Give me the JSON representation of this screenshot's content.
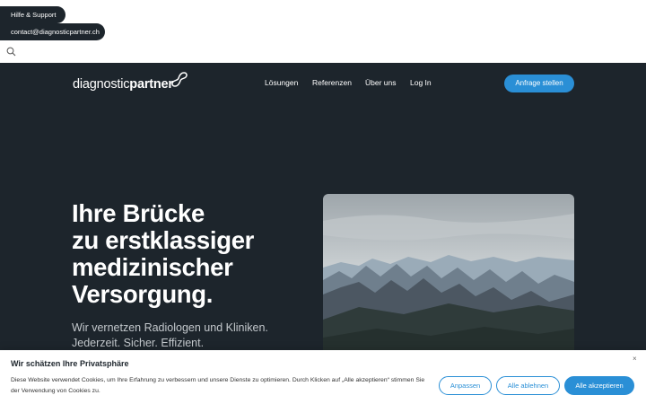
{
  "topbar": {
    "help_label": "Hilfe & Support",
    "email_label": "contact@diagnosticpartner.ch",
    "search_icon": "search-icon"
  },
  "header": {
    "logo_light": "diagnostic",
    "logo_bold": "partner",
    "nav": [
      "Lösungen",
      "Referenzen",
      "Über uns",
      "Log In"
    ],
    "cta_label": "Anfrage stellen"
  },
  "hero": {
    "headline": [
      "Ihre Brücke",
      "zu erstklassiger",
      "medizinischer",
      "Versorgung."
    ],
    "subline": [
      "Wir vernetzen Radiologen und Kliniken.",
      "Jederzeit. Sicher. Effizient."
    ]
  },
  "cookie_banner": {
    "title": "Wir schätzen Ihre Privatsphäre",
    "text": "Diese Website verwendet Cookies, um Ihre Erfahrung zu verbessern und unsere Dienste zu optimieren. Durch Klicken auf „Alle akzeptieren“ stimmen Sie der Verwendung von Cookies zu.",
    "close_symbol": "×",
    "buttons": [
      "Anpassen",
      "Alle ablehnen",
      "Alle akzeptieren"
    ]
  },
  "colors": {
    "dark_bg": "#1d252c",
    "accent": "#2a8fd6"
  }
}
